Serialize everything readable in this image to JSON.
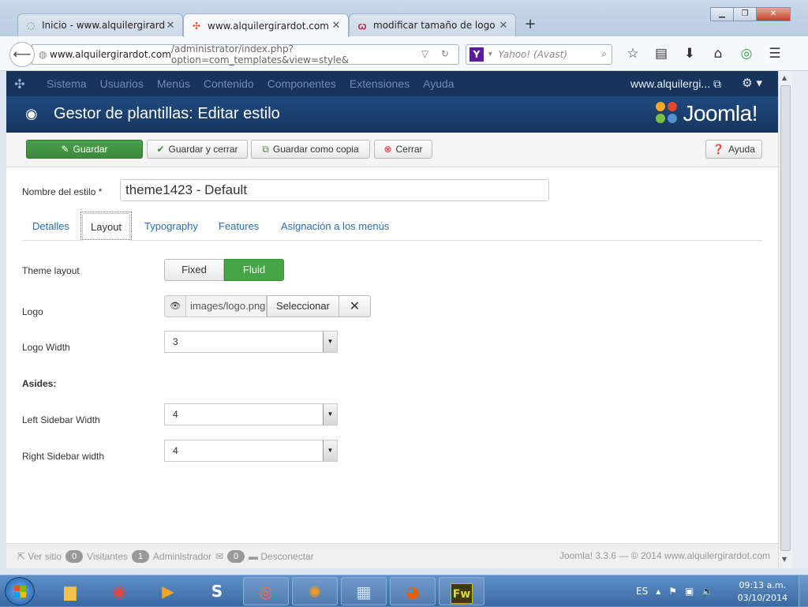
{
  "browser": {
    "tabs": [
      {
        "title": "Inicio - www.alquilergirard...",
        "active": false
      },
      {
        "title": "www.alquilergirardot.com ...",
        "active": true
      },
      {
        "title": "modificar tamaño de logo ...",
        "active": false
      }
    ],
    "url_host": "www.alquilergirardot.com",
    "url_path": "/administrator/index.php?option=com_templates&view=style&",
    "search_placeholder": "Yahoo! (Avast)"
  },
  "jnav": {
    "menu": [
      "Sistema",
      "Usuarios",
      "Menús",
      "Contenido",
      "Componentes",
      "Extensiones",
      "Ayuda"
    ],
    "site_link": "www.alquilergi..."
  },
  "header": {
    "title": "Gestor de plantillas: Editar estilo",
    "brand": "Joomla!"
  },
  "toolbar": {
    "save": "Guardar",
    "save_close": "Guardar y cerrar",
    "save_copy": "Guardar como copia",
    "close": "Cerrar",
    "help": "Ayuda"
  },
  "form": {
    "style_name_label": "Nombre del estilo *",
    "style_name_value": "theme1423 - Default",
    "tabs": [
      "Detalles",
      "Layout",
      "Typography",
      "Features",
      "Asignación a los menús"
    ],
    "theme_layout_label": "Theme layout",
    "layout_options": [
      "Fixed",
      "Fluid"
    ],
    "logo_label": "Logo",
    "logo_path": "images/logo.png",
    "logo_select": "Seleccionar",
    "logo_width_label": "Logo Width",
    "logo_width_value": "3",
    "asides_label": "Asides:",
    "left_sidebar_label": "Left Sidebar Width",
    "left_sidebar_value": "4",
    "right_sidebar_label": "Right Sidebar width",
    "right_sidebar_value": "4"
  },
  "footer": {
    "view_site": "Ver sitio",
    "visitors_count": "0",
    "visitors_label": "Visitantes",
    "admin_count": "1",
    "admin_label": "Administrador",
    "messages_count": "0",
    "logout": "Desconectar",
    "copyright": "Joomla! 3.3.6  —  © 2014 www.alquilergirardot.com"
  },
  "taskbar": {
    "language": "ES",
    "time": "09:13 a.m.",
    "date": "03/10/2014"
  },
  "colors": {
    "joomla_navbar": "#17345d",
    "success_green": "#46a546",
    "link_blue": "#2a6faf"
  }
}
